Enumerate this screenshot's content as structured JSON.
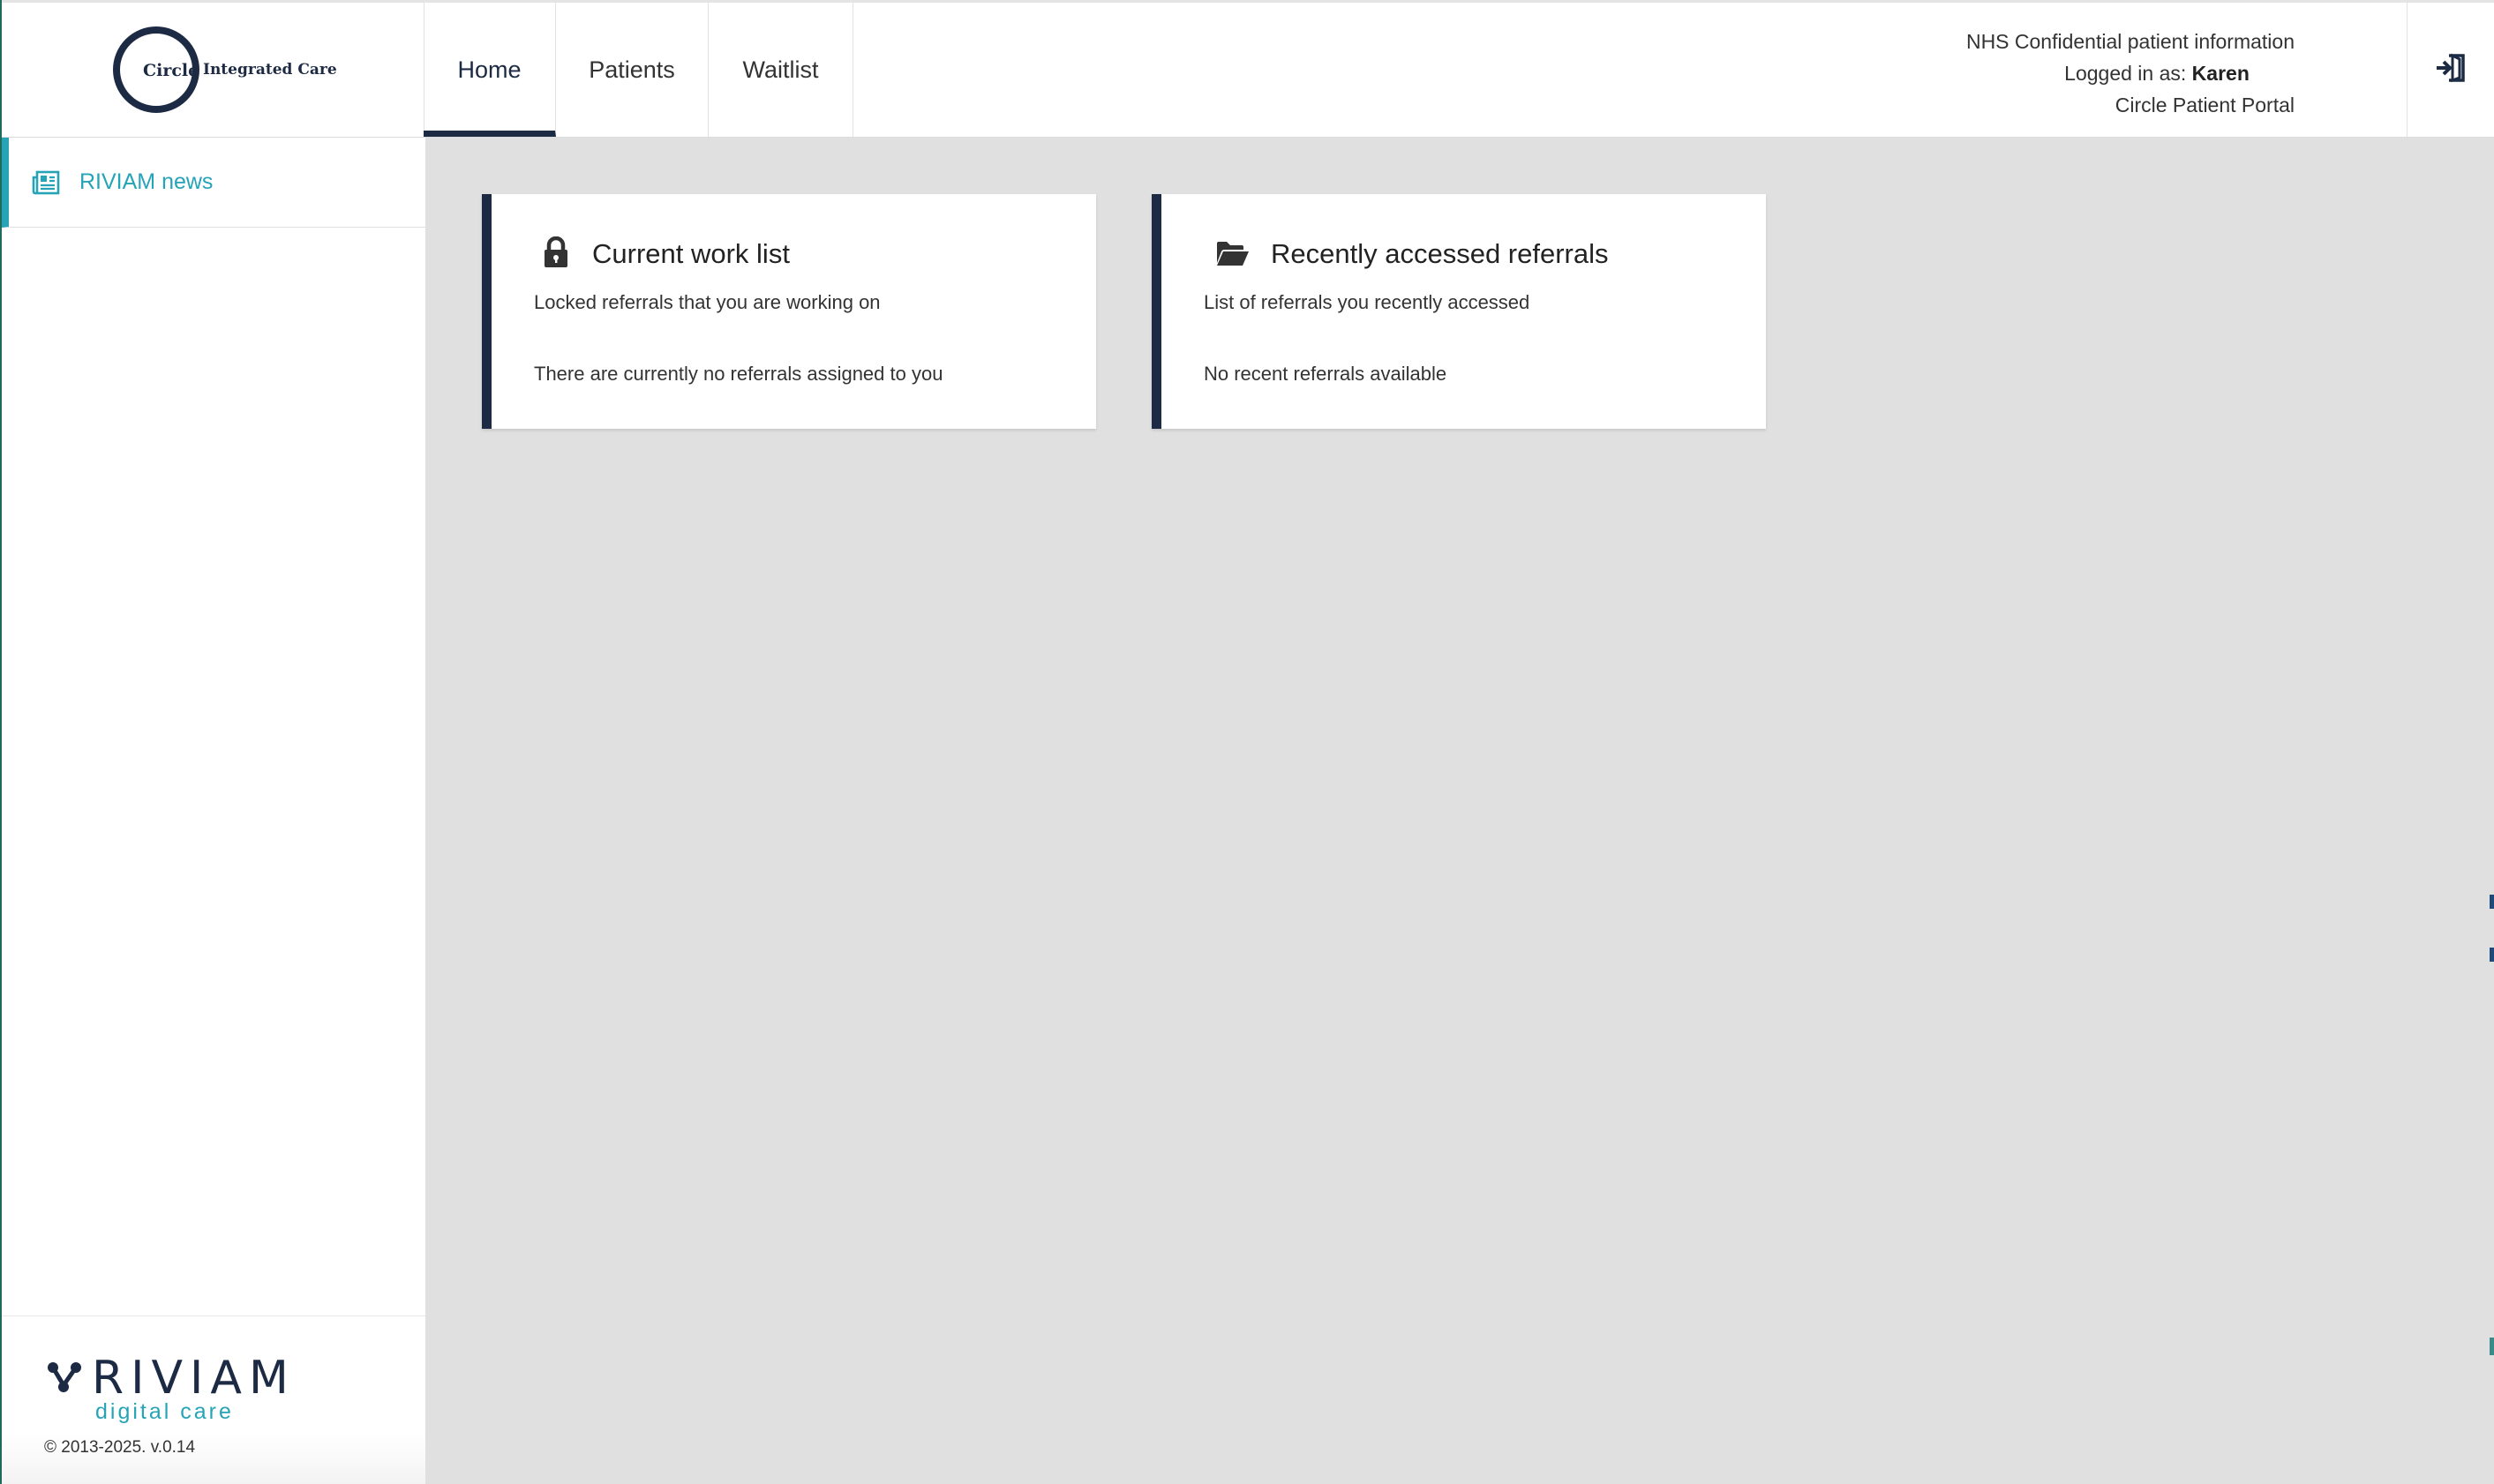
{
  "app": {
    "brand": "Circle",
    "brand_sub": "Integrated Care"
  },
  "nav": {
    "tabs": [
      {
        "label": "Home",
        "active": true
      },
      {
        "label": "Patients",
        "active": false
      },
      {
        "label": "Waitlist",
        "active": false
      }
    ]
  },
  "header_info": {
    "line1": "NHS Confidential patient information",
    "logged_in_prefix": "Logged in as: ",
    "user": "Karen",
    "line3": "Circle Patient Portal",
    "logout_icon": "sign-out-icon"
  },
  "sidebar": {
    "items": [
      {
        "label": "RIVIAM news",
        "icon": "newspaper-icon"
      }
    ],
    "footer": {
      "brand": "RIVIAM",
      "tagline": "digital care",
      "copyright": "© 2013-2025. v.0.14"
    }
  },
  "cards": [
    {
      "title": "Current work list",
      "icon": "lock-icon",
      "description": "Locked referrals that you are working on",
      "empty_message": "There are currently no referrals assigned to you"
    },
    {
      "title": "Recently accessed referrals",
      "icon": "folder-open-icon",
      "description": "List of referrals you recently accessed",
      "empty_message": "No recent referrals available"
    }
  ],
  "colors": {
    "primary": "#1d2a44",
    "accent": "#27a3b8",
    "background": "#e0e0e0"
  }
}
